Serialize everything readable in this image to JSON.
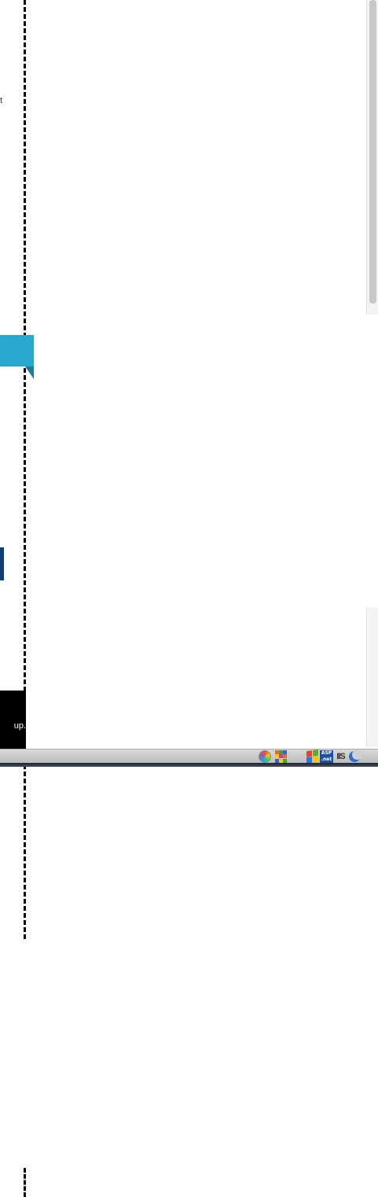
{
  "left_panel": {
    "edge_mark_text": "t",
    "tooltip_text": "up."
  },
  "status_bar": {
    "icons": [
      "color-wheel-icon",
      "color-grid-icon",
      "windows-flag-icon",
      "asp-net-icon",
      "iis-icon",
      "crescent-icon"
    ],
    "asp_label": "ASP .net",
    "iis_label": "IIS"
  },
  "colors": {
    "ribbon": "#2aa7cc",
    "ribbon_fold": "#1e7c98",
    "side_tab": "#0e3f6e",
    "tooltip_bg": "#000000",
    "status_bar": "#c8c8c8"
  }
}
